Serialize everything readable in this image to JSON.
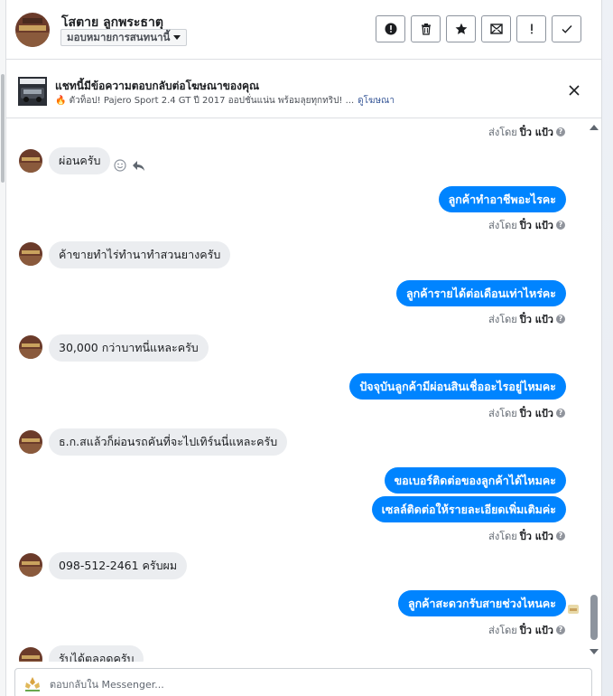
{
  "header": {
    "user_name": "โสตาย ลูกพระธาตุ",
    "assign_label": "มอบหมายการสนทนานี้",
    "actions": [
      {
        "icon": "alert-circle-icon",
        "name": "mark-spam-button"
      },
      {
        "icon": "trash-icon",
        "name": "delete-button"
      },
      {
        "icon": "star-icon",
        "name": "star-button"
      },
      {
        "icon": "mark-unread-icon",
        "name": "mark-unread-button"
      },
      {
        "icon": "exclamation-icon",
        "name": "follow-up-button"
      },
      {
        "icon": "checkmark-icon",
        "name": "mark-done-button"
      }
    ]
  },
  "ad": {
    "title": "แชทนี้มีข้อความตอบกลับต่อโฆษณาของคุณ",
    "subtitle": "🔥 ตัวท็อป! Pajero Sport 2.4 GT ปี 2017 ออปชั่นแน่น พร้อมลุยทุกทริป! ...",
    "link": "ดูโฆษณา"
  },
  "thread": {
    "sent_by_prefix": "ส่งโดย",
    "sent_by_name": "ปิ๋ว แป้ว",
    "messages": [
      {
        "dir": "meta"
      },
      {
        "dir": "in",
        "text": "ผ่อนครับ"
      },
      {
        "dir": "out",
        "text": "ลูกค้าทำอาชีพอะไรคะ"
      },
      {
        "dir": "meta"
      },
      {
        "dir": "in",
        "text": "ค้าขายทำไร่ทำนาทำสวนยางครับ"
      },
      {
        "dir": "out",
        "text": "ลูกค้ารายได้ต่อเดือนเท่าไหร่คะ"
      },
      {
        "dir": "meta"
      },
      {
        "dir": "in",
        "text": "30,000 กว่าบาทนี่แหละครับ"
      },
      {
        "dir": "out",
        "text": "ปัจจุบันลูกค้ามีผ่อนสินเชื่ออะไรอยู่ไหมคะ"
      },
      {
        "dir": "meta"
      },
      {
        "dir": "in",
        "text": "ธ.ก.สแล้วก็ผ่อนรถคันที่จะไปเทิร์นนี่แหละครับ"
      },
      {
        "dir": "out",
        "text": "ขอเบอร์ติดต่อของลูกค้าได้ไหมคะ"
      },
      {
        "dir": "out",
        "text": "เซลล์ติดต่อให้รายละเอียดเพิ่มเติมค่ะ"
      },
      {
        "dir": "meta"
      },
      {
        "dir": "in",
        "text": "098-512-2461 ครับผม"
      },
      {
        "dir": "out",
        "text": "ลูกค้าสะดวกรับสายช่วงไหนคะ"
      },
      {
        "dir": "meta"
      },
      {
        "dir": "in",
        "text": "รับได้ตลอดครับ"
      }
    ]
  },
  "composer": {
    "placeholder": "ตอบกลับใน Messenger..."
  }
}
